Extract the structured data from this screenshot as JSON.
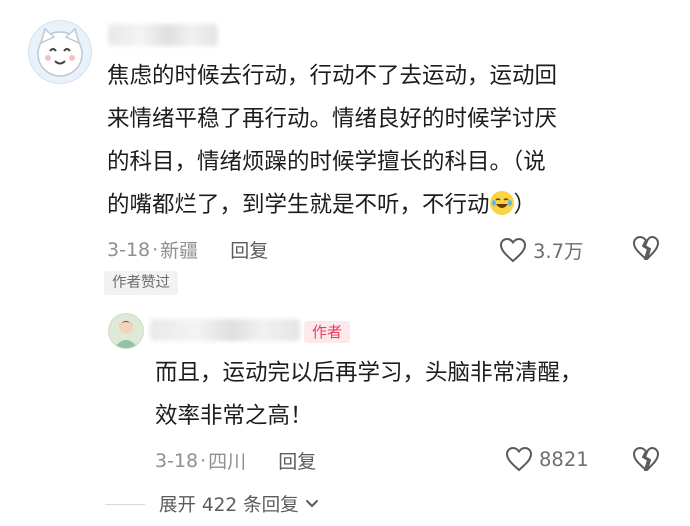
{
  "comment": {
    "text_lines": [
      "焦虑的时候去行动，行动不了去运动，运动回",
      "来情绪平稳了再行动。情绪良好的时候学讨厌",
      "的科目，情绪烦躁的时候学擅长的科目。（说",
      "的嘴都烂了，到学生就是不听，不行动"
    ],
    "text_end": "）",
    "emoji": "laugh-crying-emoji",
    "date": "3-18",
    "location": "新疆",
    "reply_label": "回复",
    "likes": "3.7万",
    "author_liked_tag": "作者赞过"
  },
  "reply": {
    "author_badge": "作者",
    "text_lines": [
      "而且，运动完以后再学习，头脑非常清醒，",
      "效率非常之高！"
    ],
    "date": "3-18",
    "location": "四川",
    "reply_label": "回复",
    "likes": "8821"
  },
  "expand_label": "展开 422 条回复",
  "colors": {
    "text": "#1d1d1d",
    "meta": "#8f8f8f",
    "author_badge_bg": "#fde9ec",
    "author_badge_text": "#ea3d5c",
    "emoji": "#fbd347"
  }
}
